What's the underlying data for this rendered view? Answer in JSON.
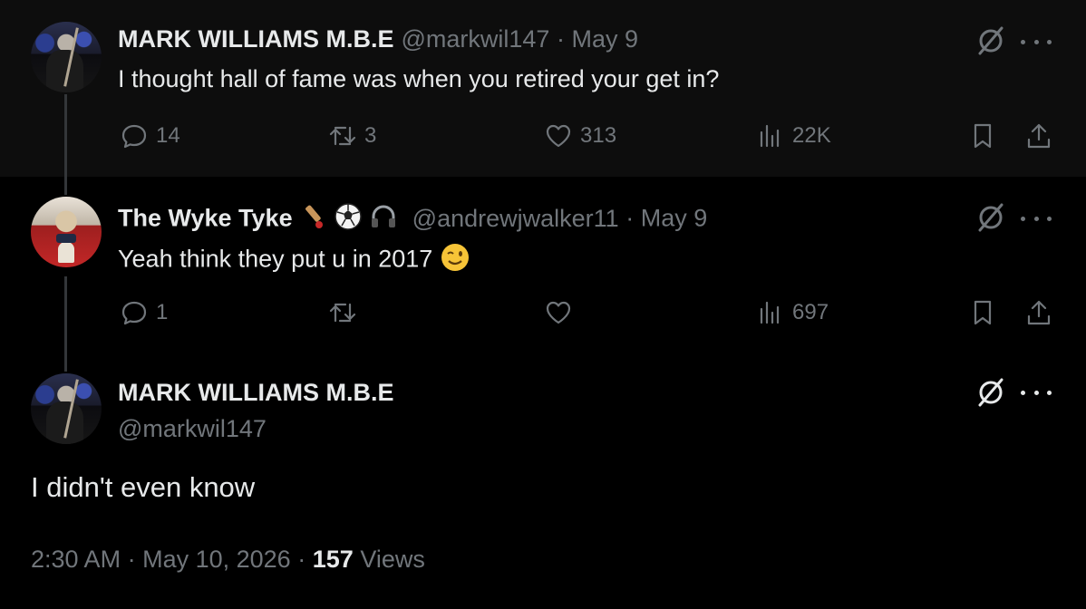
{
  "replies": [
    {
      "author_name": "MARK WILLIAMS M.B.E",
      "handle": "@markwil147",
      "separator": "·",
      "date": "May 9",
      "text": "I thought hall of fame was when you retired your get in?",
      "avatar_icon": "profile-photo-player-icon",
      "stats": {
        "replies": "14",
        "reposts": "3",
        "likes": "313",
        "views": "22K"
      }
    },
    {
      "author_name": "The Wyke Tyke",
      "author_emojis": [
        "cricket-bat-icon",
        "soccer-ball-icon",
        "headphones-icon"
      ],
      "handle": "@andrewjwalker11",
      "separator": "·",
      "date": "May 9",
      "text": "Yeah think they put u in 2017",
      "text_emoji": "winking-face-icon",
      "avatar_icon": "profile-photo-dog-icon",
      "stats": {
        "replies": "1",
        "reposts": "",
        "likes": "",
        "views": "697"
      }
    }
  ],
  "main_post": {
    "author_name": "MARK WILLIAMS M.B.E",
    "handle": "@markwil147",
    "text": "I didn't even know",
    "time": "2:30 AM",
    "separator": "·",
    "date": "May 10, 2026",
    "separator2": "·",
    "views_count": "157",
    "views_label": "Views"
  },
  "colors": {
    "background": "#000000",
    "muted": "#71767b",
    "text": "#e7e9ea",
    "divider": "#333639"
  }
}
